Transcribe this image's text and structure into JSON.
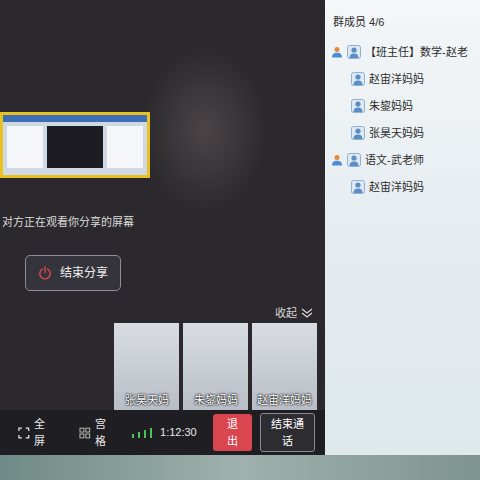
{
  "share": {
    "status": "对方正在观看你分享的屏幕",
    "stop_button": "结束分享"
  },
  "collapse": {
    "label": "收起"
  },
  "videos": [
    {
      "label": "张昊天妈"
    },
    {
      "label": "朱鋆妈妈"
    },
    {
      "label": "赵宙洋妈妈"
    }
  ],
  "toolbar": {
    "fullscreen": "全屏",
    "grid": "宫格",
    "signal": {
      "level": 1
    },
    "duration": "1:12:30",
    "exit": "退出",
    "end_call": "结束通话"
  },
  "members": {
    "title": "群成员 4/6",
    "items": [
      {
        "name": "【班主任】数学-赵老",
        "kind": "teacher"
      },
      {
        "name": "赵宙洋妈妈",
        "kind": "parent"
      },
      {
        "name": "朱鋆妈妈",
        "kind": "parent"
      },
      {
        "name": "张昊天妈妈",
        "kind": "parent"
      },
      {
        "name": "语文-武老师",
        "kind": "teacher"
      },
      {
        "name": "赵宙洋妈妈",
        "kind": "parent"
      }
    ]
  }
}
